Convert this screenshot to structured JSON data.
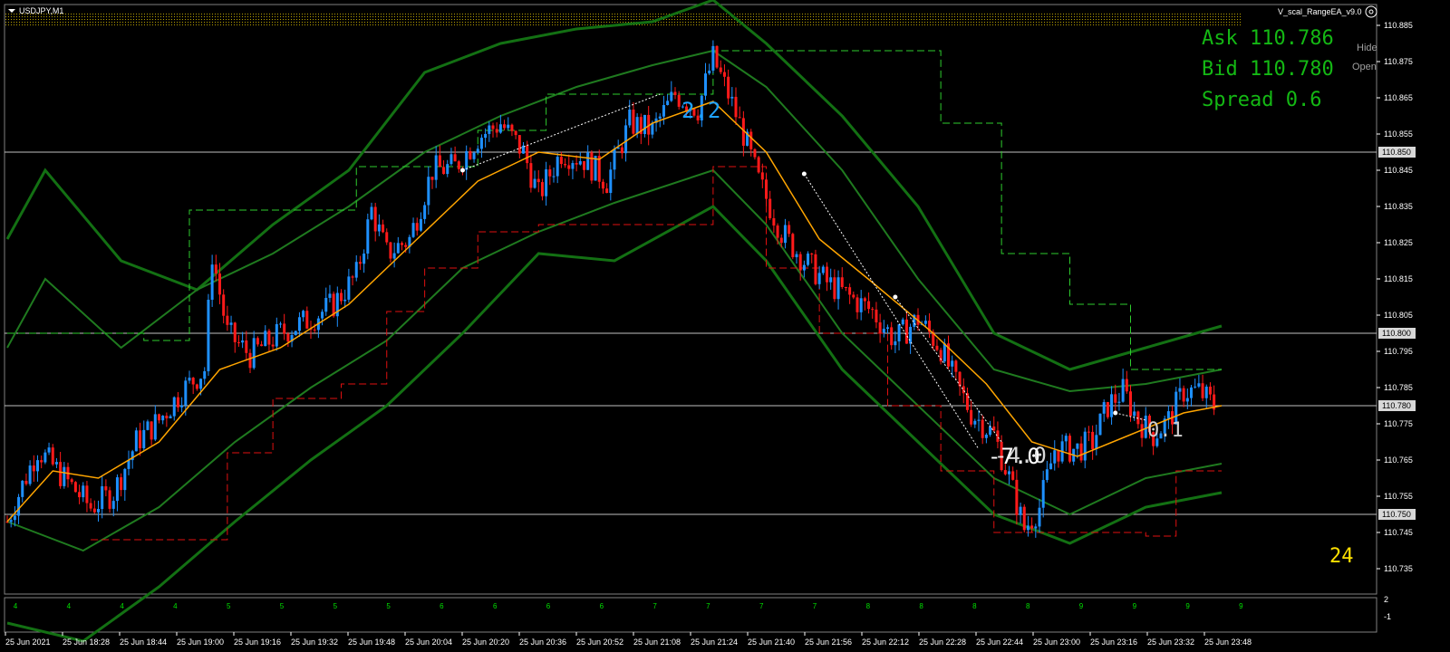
{
  "window": {
    "symbol_title": "USDJPY,M1",
    "ea_name": "V_scal_RangeEA_v9.0"
  },
  "panel": {
    "ask_label": "Ask 110.786",
    "bid_label": "Bid 110.780",
    "spread_label": "Spread 0.6",
    "hide_label": "Hide",
    "open_label": "Open"
  },
  "counter": "24",
  "trade_labels": [
    {
      "text": "2.2",
      "color": "#1fa3ff"
    },
    {
      "text": "-7.0",
      "color": "#ffffff"
    },
    {
      "text": "-4.0",
      "color": "#ffffff"
    },
    {
      "text": "0.1",
      "color": "#d0d0d0"
    }
  ],
  "price_axis": {
    "ticks": [
      "110.885",
      "110.875",
      "110.865",
      "110.855",
      "110.845",
      "110.835",
      "110.825",
      "110.815",
      "110.805",
      "110.795",
      "110.785",
      "110.775",
      "110.765",
      "110.755",
      "110.745",
      "110.735"
    ],
    "highlighted": [
      "110.850",
      "110.800",
      "110.780",
      "110.750"
    ]
  },
  "sub_axis": {
    "ticks": [
      "2",
      "-1"
    ]
  },
  "time_axis": [
    "25 Jun 2021",
    "25 Jun 18:28",
    "25 Jun 18:44",
    "25 Jun 19:00",
    "25 Jun 19:16",
    "25 Jun 19:32",
    "25 Jun 19:48",
    "25 Jun 20:04",
    "25 Jun 20:20",
    "25 Jun 20:36",
    "25 Jun 20:52",
    "25 Jun 21:08",
    "25 Jun 21:24",
    "25 Jun 21:40",
    "25 Jun 21:56",
    "25 Jun 22:12",
    "25 Jun 22:28",
    "25 Jun 22:44",
    "25 Jun 23:00",
    "25 Jun 23:16",
    "25 Jun 23:32",
    "25 Jun 23:48"
  ],
  "subwindow_digits": [
    "4",
    "4",
    "4",
    "4",
    "5",
    "5",
    "5",
    "5",
    "6",
    "6",
    "6",
    "6",
    "7",
    "7",
    "7",
    "7",
    "8",
    "8",
    "8",
    "8",
    "9",
    "9",
    "9",
    "9"
  ],
  "colors": {
    "bull": "#1e90ff",
    "bear": "#ff1a1a",
    "ma": "#ffa500",
    "band": "#1f7a1f",
    "band_outer": "#137013",
    "channel_upper": "#2ecc2e",
    "channel_lower": "#e01010",
    "grid": "#c0c0c0",
    "info": "#14b814"
  },
  "chart_data": {
    "type": "candlestick",
    "symbol": "USDJPY",
    "timeframe": "M1",
    "y_range": [
      110.73,
      110.89
    ],
    "horizontal_levels": [
      110.85,
      110.8,
      110.78,
      110.75
    ],
    "current_price": 110.78,
    "close_path": [
      [
        0,
        110.748
      ],
      [
        8,
        110.768
      ],
      [
        15,
        110.76
      ],
      [
        22,
        110.752
      ],
      [
        28,
        110.756
      ],
      [
        34,
        110.77
      ],
      [
        40,
        110.776
      ],
      [
        46,
        110.784
      ],
      [
        52,
        110.79
      ],
      [
        54,
        110.822
      ],
      [
        58,
        110.8
      ],
      [
        64,
        110.794
      ],
      [
        72,
        110.8
      ],
      [
        80,
        110.804
      ],
      [
        86,
        110.808
      ],
      [
        92,
        110.816
      ],
      [
        96,
        110.834
      ],
      [
        100,
        110.822
      ],
      [
        106,
        110.826
      ],
      [
        112,
        110.845
      ],
      [
        118,
        110.846
      ],
      [
        124,
        110.854
      ],
      [
        130,
        110.858
      ],
      [
        136,
        110.85
      ],
      [
        140,
        110.838
      ],
      [
        146,
        110.85
      ],
      [
        152,
        110.848
      ],
      [
        158,
        110.842
      ],
      [
        164,
        110.858
      ],
      [
        170,
        110.856
      ],
      [
        176,
        110.866
      ],
      [
        182,
        110.862
      ],
      [
        186,
        110.876
      ],
      [
        190,
        110.866
      ],
      [
        194,
        110.855
      ],
      [
        198,
        110.842
      ],
      [
        204,
        110.828
      ],
      [
        210,
        110.82
      ],
      [
        216,
        110.814
      ],
      [
        222,
        110.81
      ],
      [
        228,
        110.806
      ],
      [
        234,
        110.798
      ],
      [
        240,
        110.804
      ],
      [
        246,
        110.796
      ],
      [
        250,
        110.786
      ],
      [
        254,
        110.778
      ],
      [
        260,
        110.772
      ],
      [
        264,
        110.76
      ],
      [
        268,
        110.746
      ],
      [
        272,
        110.752
      ],
      [
        276,
        110.768
      ],
      [
        282,
        110.768
      ],
      [
        286,
        110.77
      ],
      [
        290,
        110.78
      ],
      [
        294,
        110.784
      ],
      [
        298,
        110.776
      ],
      [
        302,
        110.772
      ],
      [
        306,
        110.776
      ],
      [
        310,
        110.784
      ],
      [
        314,
        110.784
      ],
      [
        318,
        110.78
      ]
    ],
    "moving_average": [
      [
        0,
        110.748
      ],
      [
        12,
        110.762
      ],
      [
        24,
        110.76
      ],
      [
        40,
        110.77
      ],
      [
        56,
        110.79
      ],
      [
        72,
        110.796
      ],
      [
        90,
        110.808
      ],
      [
        108,
        110.826
      ],
      [
        124,
        110.842
      ],
      [
        140,
        110.85
      ],
      [
        156,
        110.848
      ],
      [
        170,
        110.858
      ],
      [
        186,
        110.864
      ],
      [
        200,
        110.85
      ],
      [
        214,
        110.826
      ],
      [
        228,
        110.814
      ],
      [
        244,
        110.8
      ],
      [
        258,
        110.786
      ],
      [
        270,
        110.77
      ],
      [
        282,
        110.766
      ],
      [
        296,
        110.772
      ],
      [
        310,
        110.778
      ],
      [
        320,
        110.78
      ]
    ],
    "bands": {
      "upper_outer": [
        [
          0,
          110.826
        ],
        [
          10,
          110.845
        ],
        [
          30,
          110.82
        ],
        [
          50,
          110.812
        ],
        [
          70,
          110.83
        ],
        [
          90,
          110.845
        ],
        [
          110,
          110.872
        ],
        [
          130,
          110.88
        ],
        [
          150,
          110.884
        ],
        [
          170,
          110.886
        ],
        [
          186,
          110.892
        ],
        [
          200,
          110.88
        ],
        [
          220,
          110.86
        ],
        [
          240,
          110.835
        ],
        [
          260,
          110.8
        ],
        [
          280,
          110.79
        ],
        [
          300,
          110.796
        ],
        [
          320,
          110.802
        ]
      ],
      "upper": [
        [
          0,
          110.796
        ],
        [
          10,
          110.815
        ],
        [
          30,
          110.796
        ],
        [
          50,
          110.812
        ],
        [
          70,
          110.822
        ],
        [
          90,
          110.835
        ],
        [
          110,
          110.85
        ],
        [
          130,
          110.86
        ],
        [
          150,
          110.868
        ],
        [
          170,
          110.874
        ],
        [
          186,
          110.878
        ],
        [
          200,
          110.868
        ],
        [
          220,
          110.845
        ],
        [
          240,
          110.815
        ],
        [
          260,
          110.79
        ],
        [
          280,
          110.784
        ],
        [
          300,
          110.786
        ],
        [
          320,
          110.79
        ]
      ],
      "lower": [
        [
          0,
          110.748
        ],
        [
          20,
          110.74
        ],
        [
          40,
          110.752
        ],
        [
          60,
          110.77
        ],
        [
          80,
          110.785
        ],
        [
          100,
          110.798
        ],
        [
          120,
          110.818
        ],
        [
          140,
          110.828
        ],
        [
          160,
          110.836
        ],
        [
          186,
          110.845
        ],
        [
          200,
          110.83
        ],
        [
          220,
          110.8
        ],
        [
          240,
          110.78
        ],
        [
          260,
          110.76
        ],
        [
          280,
          110.75
        ],
        [
          300,
          110.76
        ],
        [
          320,
          110.764
        ]
      ],
      "lower_outer": [
        [
          0,
          110.72
        ],
        [
          20,
          110.715
        ],
        [
          40,
          110.73
        ],
        [
          60,
          110.748
        ],
        [
          80,
          110.765
        ],
        [
          100,
          110.78
        ],
        [
          120,
          110.8
        ],
        [
          140,
          110.822
        ],
        [
          160,
          110.82
        ],
        [
          186,
          110.835
        ],
        [
          200,
          110.82
        ],
        [
          220,
          110.79
        ],
        [
          240,
          110.77
        ],
        [
          260,
          110.75
        ],
        [
          280,
          110.742
        ],
        [
          300,
          110.752
        ],
        [
          320,
          110.756
        ]
      ]
    },
    "channel_upper": [
      [
        0,
        110.8
      ],
      [
        36,
        110.798
      ],
      [
        48,
        110.834
      ],
      [
        84,
        110.834
      ],
      [
        92,
        110.846
      ],
      [
        112,
        110.846
      ],
      [
        124,
        110.856
      ],
      [
        142,
        110.866
      ],
      [
        176,
        110.866
      ],
      [
        186,
        110.878
      ],
      [
        238,
        110.878
      ],
      [
        246,
        110.858
      ],
      [
        262,
        110.822
      ],
      [
        280,
        110.808
      ],
      [
        296,
        110.79
      ],
      [
        320,
        110.79
      ]
    ],
    "channel_lower": [
      [
        22,
        110.743
      ],
      [
        44,
        110.743
      ],
      [
        58,
        110.767
      ],
      [
        70,
        110.782
      ],
      [
        88,
        110.786
      ],
      [
        100,
        110.806
      ],
      [
        110,
        110.818
      ],
      [
        124,
        110.828
      ],
      [
        140,
        110.83
      ],
      [
        156,
        110.83
      ],
      [
        186,
        110.846
      ],
      [
        200,
        110.818
      ],
      [
        214,
        110.8
      ],
      [
        232,
        110.78
      ],
      [
        246,
        110.762
      ],
      [
        260,
        110.745
      ],
      [
        282,
        110.745
      ],
      [
        300,
        110.744
      ],
      [
        308,
        110.762
      ],
      [
        320,
        110.762
      ]
    ]
  }
}
